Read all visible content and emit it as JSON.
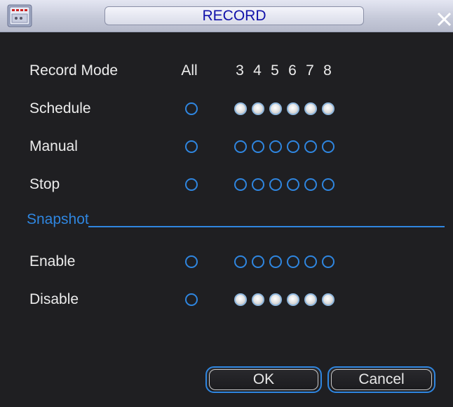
{
  "window": {
    "title": "RECORD"
  },
  "header": {
    "label": "Record Mode",
    "all": "All",
    "channels": [
      "3",
      "4",
      "5",
      "6",
      "7",
      "8"
    ]
  },
  "rows": [
    {
      "label": "Schedule",
      "all": false,
      "channels": [
        true,
        true,
        true,
        true,
        true,
        true
      ]
    },
    {
      "label": "Manual",
      "all": false,
      "channels": [
        false,
        false,
        false,
        false,
        false,
        false
      ]
    },
    {
      "label": "Stop",
      "all": false,
      "channels": [
        false,
        false,
        false,
        false,
        false,
        false
      ]
    }
  ],
  "snapshot": {
    "label": "Snapshot",
    "rows": [
      {
        "label": "Enable",
        "all": false,
        "channels": [
          false,
          false,
          false,
          false,
          false,
          false
        ]
      },
      {
        "label": "Disable",
        "all": false,
        "channels": [
          true,
          true,
          true,
          true,
          true,
          true
        ]
      }
    ]
  },
  "buttons": {
    "ok": "OK",
    "cancel": "Cancel"
  },
  "colors": {
    "accent": "#2f86e0",
    "background": "#1f1f22",
    "title_text": "#1111aa"
  }
}
